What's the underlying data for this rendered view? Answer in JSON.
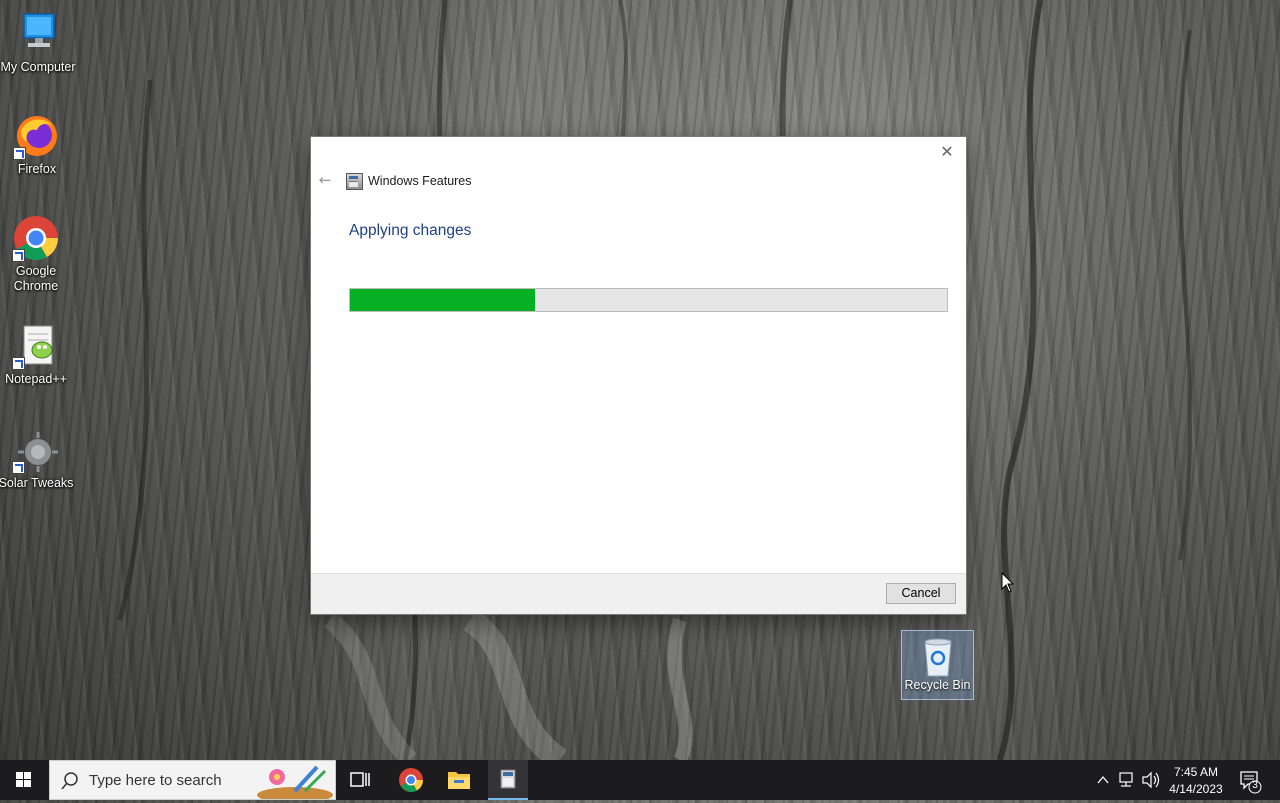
{
  "desktop": {
    "icons": [
      {
        "label": "My Computer",
        "icon": "monitor-icon"
      },
      {
        "label": "Firefox",
        "icon": "firefox-icon"
      },
      {
        "label": "Google Chrome",
        "icon": "chrome-icon"
      },
      {
        "label": "Notepad++",
        "icon": "notepad-plus-plus-icon"
      },
      {
        "label": "Solar Tweaks",
        "icon": "solar-tweaks-icon"
      }
    ],
    "recycle_bin": {
      "label": "Recycle Bin",
      "icon": "recycle-bin-icon"
    }
  },
  "dialog": {
    "title": "Windows Features",
    "heading": "Applying changes",
    "progress_percent": 31,
    "progress_color": "#06b025",
    "cancel_label": "Cancel",
    "close_icon": "close-icon",
    "back_icon": "back-arrow-icon"
  },
  "taskbar": {
    "search_placeholder": "Type here to search",
    "time": "7:45 AM",
    "date": "4/14/2023",
    "notification_count": "3",
    "pinned": [
      "task-view-icon",
      "chrome-icon",
      "file-explorer-icon",
      "windows-features-icon"
    ]
  }
}
